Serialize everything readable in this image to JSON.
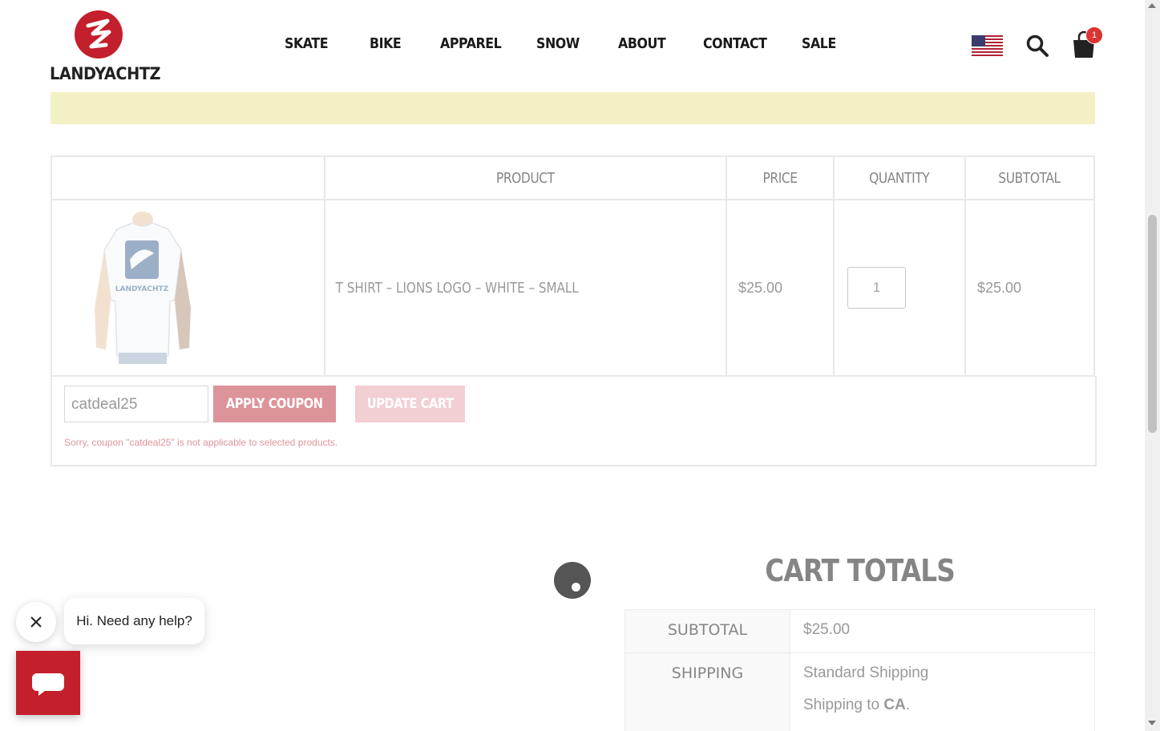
{
  "brand": {
    "name": "LANDYACHTZ"
  },
  "nav": {
    "items": [
      "SKATE",
      "BIKE",
      "APPAREL",
      "SNOW",
      "ABOUT",
      "CONTACT",
      "SALE"
    ]
  },
  "header_icons": {
    "flag": "us-flag-icon",
    "search": "search-icon",
    "cart": "shopping-bag-icon",
    "cart_count": "1"
  },
  "notice": {
    "text": ""
  },
  "cart_table": {
    "headers": [
      "",
      "PRODUCT",
      "PRICE",
      "QUANTITY",
      "SUBTOTAL"
    ],
    "rows": [
      {
        "product": "T SHIRT – LIONS LOGO – WHITE – SMALL",
        "price": "$25.00",
        "quantity": "1",
        "subtotal": "$25.00",
        "shirt_print": "LANDYACHTZ"
      }
    ]
  },
  "coupon": {
    "value": "catdeal25",
    "apply_label": "APPLY COUPON",
    "update_label": "UPDATE CART",
    "error": "Sorry, coupon \"catdeal25\" is not applicable to selected products."
  },
  "totals": {
    "title": "CART TOTALS",
    "subtotal_label": "SUBTOTAL",
    "subtotal_value": "$25.00",
    "shipping_label": "SHIPPING",
    "shipping_method": "Standard Shipping",
    "shipping_to_prefix": "Shipping to ",
    "shipping_to_region": "CA",
    "shipping_to_suffix": "."
  },
  "chat": {
    "greeting": "Hi. Need any help?"
  },
  "colors": {
    "brand_red": "#c41f2c",
    "notice_yellow": "#f1f0c1",
    "apply_button": "#c23b47"
  }
}
